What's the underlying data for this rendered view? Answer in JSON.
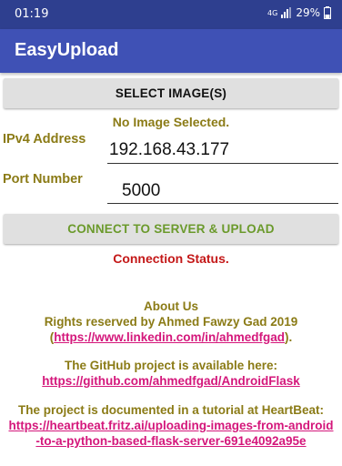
{
  "status_bar": {
    "time": "01:19",
    "network": "4G",
    "battery": "29%"
  },
  "app_bar": {
    "title": "EasyUpload"
  },
  "select_button": {
    "label": "SELECT IMAGE(S)"
  },
  "image_status": "No Image Selected.",
  "ip_label": "IPv4 Address",
  "ip_value": "192.168.43.177",
  "port_label": "Port Number",
  "port_value": "5000",
  "connect_button": {
    "label": "CONNECT TO SERVER & UPLOAD"
  },
  "connection_status": "Connection Status.",
  "about": {
    "heading": "About Us",
    "rights": "Rights reserved by Ahmed Fawzy Gad 2019",
    "linkedin_open": "(",
    "linkedin_url": "https://www.linkedin.com/in/ahmedfgad",
    "linkedin_close": ").",
    "github_text": "The GitHub project is available here:",
    "github_url": "https://github.com/ahmedfgad/AndroidFlask",
    "tutorial_text": "The project is documented in a tutorial at HeartBeat:",
    "tutorial_url_line1": "https://heartbeat.fritz.ai/uploading-images-from-android",
    "tutorial_url_line2": "-to-a-python-based-flask-server-691e4092a95e"
  },
  "colors": {
    "status_bar": "#2e3f8f",
    "app_bar": "#3f51b5",
    "olive_text": "#8b7b16",
    "connect_text": "#6b9a2c",
    "status_red": "#c41818",
    "link": "#d4177b"
  }
}
